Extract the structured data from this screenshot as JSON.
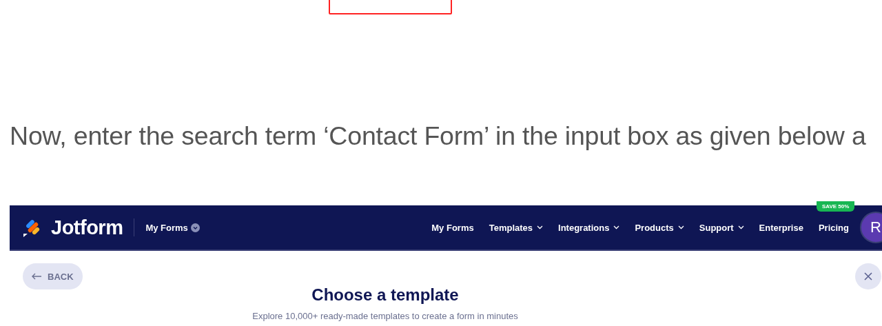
{
  "instruction": "Now, enter the search term ‘Contact Form’ in the input box as given below a",
  "screenshot": {
    "navbar": {
      "logo": "Jotform",
      "workspace": "My Forms",
      "links": [
        {
          "label": "My Forms",
          "dropdown": false
        },
        {
          "label": "Templates",
          "dropdown": true
        },
        {
          "label": "Integrations",
          "dropdown": true
        },
        {
          "label": "Products",
          "dropdown": true
        },
        {
          "label": "Support",
          "dropdown": true
        },
        {
          "label": "Enterprise",
          "dropdown": false
        }
      ],
      "pricing": {
        "label": "Pricing",
        "badge": "SAVE 50%"
      },
      "avatar": "R"
    },
    "back_button": "BACK",
    "title": "Choose a template",
    "subtitle": "Explore 10,000+ ready-made templates to create a form in minutes"
  }
}
